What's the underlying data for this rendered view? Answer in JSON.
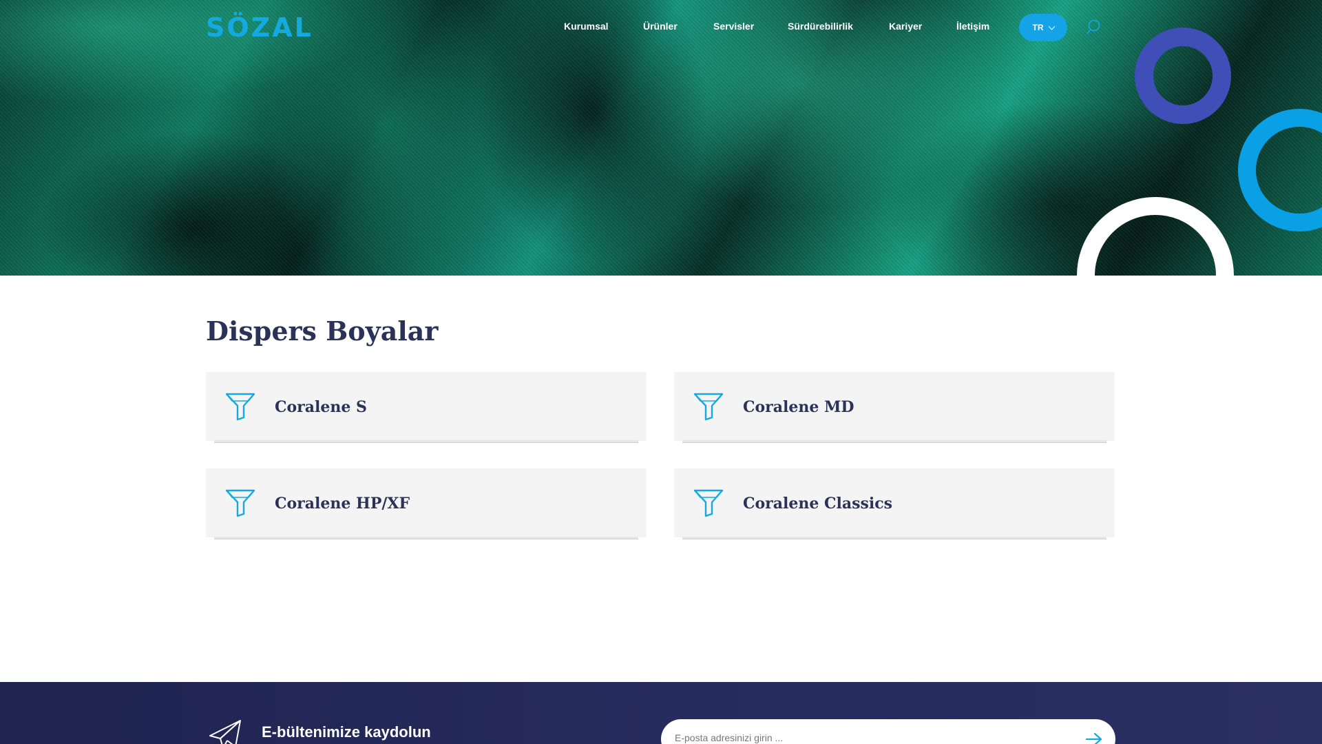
{
  "brand": {
    "logo_text": "SÖZAL",
    "accent": "#15a9e2"
  },
  "nav": {
    "items": [
      {
        "label": "Kurumsal"
      },
      {
        "label": "Ürünler"
      },
      {
        "label": "Servisler"
      },
      {
        "label": "Sürdürebilirlik"
      },
      {
        "label": "Kariyer"
      },
      {
        "label": "İletişim"
      }
    ],
    "language": "TR"
  },
  "page": {
    "title": "Dispers Boyalar"
  },
  "products": [
    {
      "label": "Coralene S",
      "icon": "funnel-icon"
    },
    {
      "label": "Coralene MD",
      "icon": "funnel-icon"
    },
    {
      "label": "Coralene HP/XF",
      "icon": "funnel-icon"
    },
    {
      "label": "Coralene Classics",
      "icon": "funnel-icon"
    }
  ],
  "newsletter": {
    "title": "E-bültenimize kaydolun",
    "subtitle": "",
    "placeholder": "E-posta adresinizi girin ...",
    "icon": "paper-plane-icon"
  },
  "colors": {
    "title_text": "#2a3258",
    "footer_bg": "#232857",
    "ring_indigo": "#3f4fb7",
    "ring_cyan": "#0aa0e6",
    "card_bg": "#f4f4f4"
  }
}
